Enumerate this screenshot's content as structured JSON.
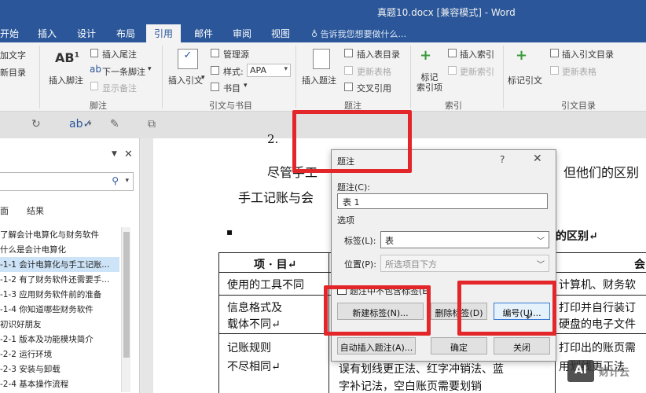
{
  "window": {
    "title": "真题10.docx [兼容模式] - Word"
  },
  "tabs": [
    {
      "label": "开始"
    },
    {
      "label": "插入"
    },
    {
      "label": "设计"
    },
    {
      "label": "布局"
    },
    {
      "label": "引用"
    },
    {
      "label": "邮件"
    },
    {
      "label": "审阅"
    },
    {
      "label": "视图"
    }
  ],
  "tell_me": "告诉我您想要做什么...",
  "ribbon": {
    "toc": {
      "add_text": "加文字",
      "update_toc": "新目录"
    },
    "footnotes": {
      "insert_footnote": "插入脚注",
      "insert_endnote": "插入尾注",
      "next_footnote": "下一条脚注",
      "show_notes": "显示备注",
      "group": "脚注"
    },
    "citations": {
      "insert_citation": "插入引文",
      "manage_sources": "管理源",
      "style_label": "样式:",
      "style_value": "APA",
      "bibliography": "书目",
      "group": "引文与书目"
    },
    "captions": {
      "insert_caption": "插入题注",
      "insert_table_of_figures": "插入表目录",
      "update_table": "更新表格",
      "cross_reference": "交叉引用",
      "group": "题注"
    },
    "index": {
      "mark_entry": "标记\n索引项",
      "insert_index": "插入索引",
      "update_index": "更新索引",
      "group": "索引"
    },
    "toa": {
      "mark_citation": "标记引文",
      "insert_toa": "插入引文目录",
      "update_toa": "更新表格",
      "group": "引文目录"
    }
  },
  "nav": {
    "tabs": [
      "面",
      "结果"
    ],
    "items": [
      {
        "text": "了解会计电算化与财务软件"
      },
      {
        "text": "什么是会计电算化"
      },
      {
        "text": "-1-1 会计电算化与手工记账..."
      },
      {
        "text": "-1-2 有了财务软件还需要手..."
      },
      {
        "text": "-1-3 应用财务软件前的准备"
      },
      {
        "text": "-1-4 你知道哪些财务软件"
      },
      {
        "text": "初识好朋友"
      },
      {
        "text": "-2-1 版本及功能模块简介"
      },
      {
        "text": "-2-2 运行环境"
      },
      {
        "text": "-2-3 安装与卸载"
      },
      {
        "text": "-2-4 基本操作流程"
      }
    ]
  },
  "document": {
    "heading_fragment": "2.",
    "para_line1_left": "尽管手工",
    "para_line1_right": "但他们的区别",
    "para_line2": "手工记账与会",
    "bullet": "▪",
    "section_title": "的区别↵",
    "table": {
      "header": [
        "项 · 目↵",
        "会"
      ],
      "rows": [
        {
          "left": [
            "使用的工具不同"
          ],
          "right": [
            "计算机、财务软"
          ]
        },
        {
          "left": [
            "信息格式及",
            "载体不同↵"
          ],
          "right": [
            "打印并自行装订",
            "硬盘的电子文件"
          ]
        },
        {
          "left": [
            "记账规则",
            "不尽相同↵"
          ],
          "right": [
            "打印出的账页需",
            "用划线更正法"
          ],
          "middle": [
            "误有划线更正法、红字冲销法、蓝",
            "字补记法，空白账页需要划销"
          ]
        }
      ]
    }
  },
  "dialog": {
    "title": "题注",
    "help": "?",
    "caption_label": "题注(C):",
    "caption_value": "表 1",
    "options_label": "选项",
    "label_label": "标签(L):",
    "label_value": "表",
    "position_label": "位置(P):",
    "position_value": "所选项目下方",
    "exclude_label_text": "题注中不包含标签(E)",
    "new_label_button": "新建标签(N)...",
    "delete_label_button": "删除标签(D)",
    "numbering_button": "编号(U)...",
    "auto_caption_button": "自动插入题注(A)...",
    "ok_button": "确定",
    "close_button": "关闭"
  },
  "watermark": {
    "logo": "AI",
    "text": "财计云"
  },
  "colors": {
    "ribbon_blue": "#2b579a",
    "annotation_red": "#e3262a",
    "selection": "#cde3f7"
  }
}
